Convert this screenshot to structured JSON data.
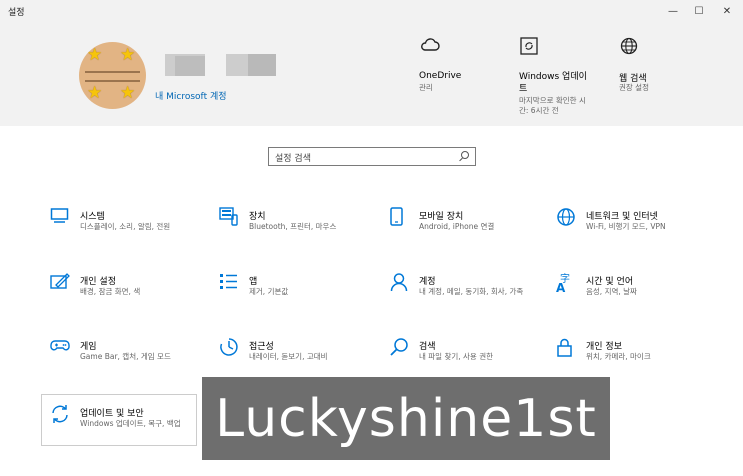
{
  "window": {
    "title": "설정",
    "minimize": "—",
    "maximize": "☐",
    "close": "✕"
  },
  "account": {
    "link": "내 Microsoft 계정"
  },
  "header_items": [
    {
      "icon": "cloud-icon",
      "title": "OneDrive",
      "subtitle": "관리"
    },
    {
      "icon": "windows-update-icon",
      "title": "Windows 업데이트",
      "subtitle": "마지막으로 확인한 시간: 6시간 전"
    },
    {
      "icon": "globe-icon",
      "title": "웹 검색",
      "subtitle": "권장 설정"
    }
  ],
  "search": {
    "placeholder": "설정 검색"
  },
  "tiles": [
    {
      "icon": "monitor-icon",
      "title": "시스템",
      "subtitle": "디스플레이, 소리, 알림, 전원"
    },
    {
      "icon": "devices-icon",
      "title": "장치",
      "subtitle": "Bluetooth, 프린터, 마우스"
    },
    {
      "icon": "phone-icon",
      "title": "모바일 장치",
      "subtitle": "Android, iPhone 연결"
    },
    {
      "icon": "network-globe-icon",
      "title": "네트워크 및 인터넷",
      "subtitle": "Wi-Fi, 비행기 모드, VPN"
    },
    {
      "icon": "personalization-icon",
      "title": "개인 설정",
      "subtitle": "배경, 잠금 화면, 색"
    },
    {
      "icon": "apps-icon",
      "title": "앱",
      "subtitle": "제거, 기본값"
    },
    {
      "icon": "person-icon",
      "title": "계정",
      "subtitle": "내 계정, 메일, 동기화, 회사, 가족"
    },
    {
      "icon": "time-language-icon",
      "title": "시간 및 언어",
      "subtitle": "음성, 지역, 날짜"
    },
    {
      "icon": "gamepad-icon",
      "title": "게임",
      "subtitle": "Game Bar, 캡처, 게임 모드"
    },
    {
      "icon": "accessibility-icon",
      "title": "접근성",
      "subtitle": "내레이터, 돋보기, 고대비"
    },
    {
      "icon": "search-icon",
      "title": "검색",
      "subtitle": "내 파일 찾기, 사용 권한"
    },
    {
      "icon": "lock-icon",
      "title": "개인 정보",
      "subtitle": "위치, 카메라, 마이크"
    },
    {
      "icon": "update-sync-icon",
      "title": "업데이트 및 보안",
      "subtitle": "Windows 업데이트, 복구, 백업"
    }
  ],
  "watermark": "Luckyshine1st"
}
